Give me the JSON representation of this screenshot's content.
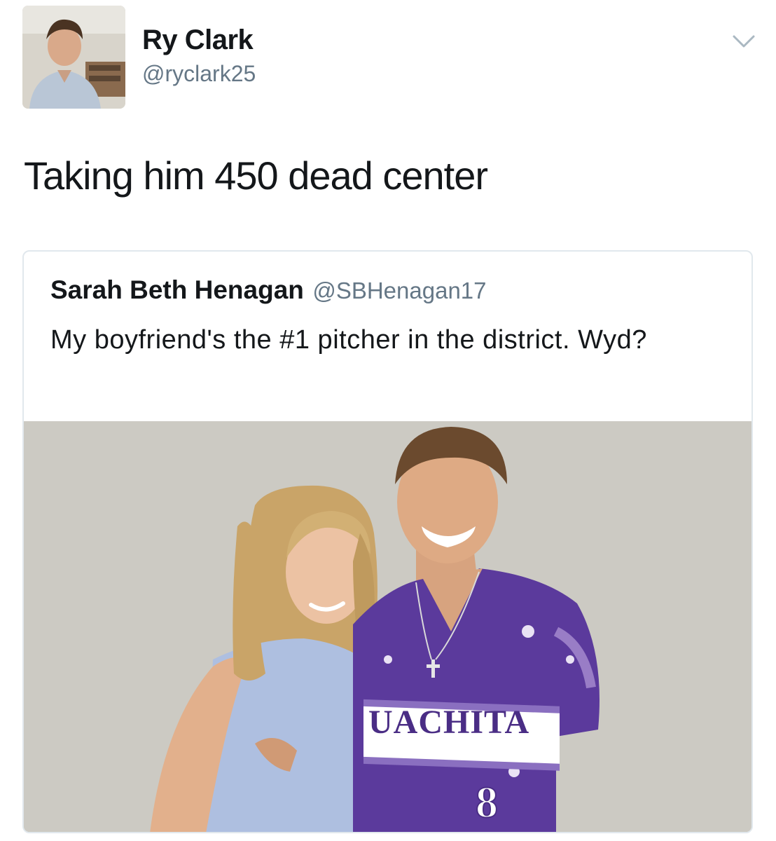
{
  "author": {
    "display_name": "Ry Clark",
    "handle": "@ryclark25"
  },
  "tweet": {
    "text": "Taking him 450 dead center"
  },
  "quoted_tweet": {
    "display_name": "Sarah Beth Henagan",
    "handle": "@SBHenagan17",
    "text": "My boyfriend's the #1 pitcher in the district. Wyd?",
    "photo": {
      "jersey_text": "UACHITA",
      "jersey_number": "8"
    }
  },
  "icons": {
    "menu": "chevron-down-icon"
  },
  "colors": {
    "name": "#14171a",
    "handle": "#657786",
    "card_border": "#e1e8ed",
    "jersey_purple": "#5b3a9c"
  }
}
